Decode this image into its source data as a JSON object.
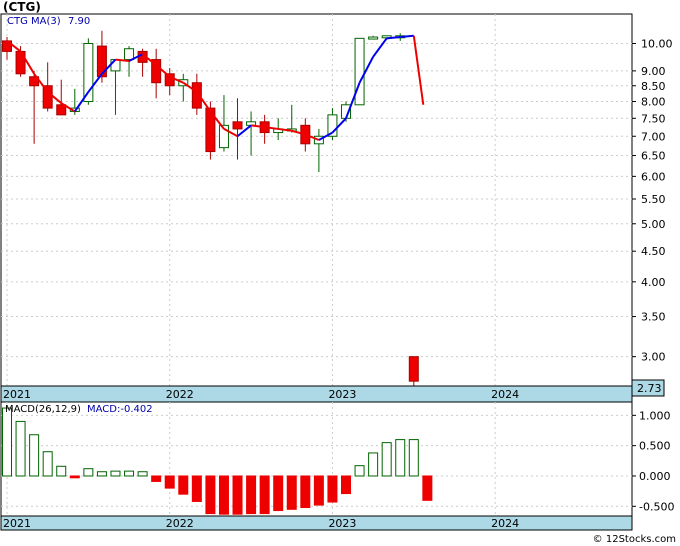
{
  "title": "(CTG)",
  "footer": "© 12Stocks.com",
  "chart_data": [
    {
      "type": "candlestick",
      "ticker_label": "CTG",
      "indicator_label": "MA(3)",
      "indicator_value": "7.90",
      "last_price_label": "2.73",
      "y_scale": "log",
      "ylim": [
        2.68,
        11.2
      ],
      "y_ticks": [
        "10.00",
        "9.00",
        "8.50",
        "8.00",
        "7.50",
        "7.00",
        "6.50",
        "6.00",
        "5.50",
        "5.00",
        "4.50",
        "4.00",
        "3.50",
        "3.00"
      ],
      "x_labels": [
        "2021",
        "2022",
        "2023",
        "2024"
      ],
      "x_label_months": [
        0,
        12,
        24,
        36
      ],
      "grid": true,
      "candles": [
        {
          "m": 0,
          "o": 10.1,
          "h": 10.25,
          "l": 9.4,
          "c": 9.7
        },
        {
          "m": 1,
          "o": 9.7,
          "h": 9.9,
          "l": 8.8,
          "c": 8.9
        },
        {
          "m": 2,
          "o": 8.8,
          "h": 9.0,
          "l": 6.8,
          "c": 8.5
        },
        {
          "m": 3,
          "o": 8.5,
          "h": 9.3,
          "l": 7.7,
          "c": 7.8
        },
        {
          "m": 4,
          "o": 7.9,
          "h": 8.7,
          "l": 7.6,
          "c": 7.6
        },
        {
          "m": 5,
          "o": 7.7,
          "h": 8.4,
          "l": 7.6,
          "c": 7.8
        },
        {
          "m": 6,
          "o": 8.0,
          "h": 10.2,
          "l": 7.9,
          "c": 10.0
        },
        {
          "m": 7,
          "o": 9.9,
          "h": 10.5,
          "l": 8.6,
          "c": 8.8
        },
        {
          "m": 8,
          "o": 9.0,
          "h": 9.3,
          "l": 7.6,
          "c": 9.4
        },
        {
          "m": 9,
          "o": 9.4,
          "h": 9.9,
          "l": 8.8,
          "c": 9.8
        },
        {
          "m": 10,
          "o": 9.7,
          "h": 9.8,
          "l": 8.8,
          "c": 9.3
        },
        {
          "m": 11,
          "o": 9.4,
          "h": 9.8,
          "l": 8.1,
          "c": 8.6
        },
        {
          "m": 12,
          "o": 8.9,
          "h": 9.1,
          "l": 8.2,
          "c": 8.5
        },
        {
          "m": 13,
          "o": 8.5,
          "h": 8.9,
          "l": 8.0,
          "c": 8.7
        },
        {
          "m": 14,
          "o": 8.6,
          "h": 8.9,
          "l": 7.6,
          "c": 7.8
        },
        {
          "m": 15,
          "o": 7.8,
          "h": 8.0,
          "l": 6.4,
          "c": 6.6
        },
        {
          "m": 16,
          "o": 6.7,
          "h": 8.2,
          "l": 6.6,
          "c": 7.3
        },
        {
          "m": 17,
          "o": 7.4,
          "h": 8.1,
          "l": 6.4,
          "c": 7.2
        },
        {
          "m": 18,
          "o": 7.3,
          "h": 7.7,
          "l": 6.5,
          "c": 7.4
        },
        {
          "m": 19,
          "o": 7.4,
          "h": 7.6,
          "l": 6.8,
          "c": 7.1
        },
        {
          "m": 20,
          "o": 7.1,
          "h": 7.5,
          "l": 6.9,
          "c": 7.2
        },
        {
          "m": 21,
          "o": 7.2,
          "h": 7.9,
          "l": 7.1,
          "c": 7.2
        },
        {
          "m": 22,
          "o": 7.3,
          "h": 7.5,
          "l": 6.6,
          "c": 6.8
        },
        {
          "m": 23,
          "o": 6.8,
          "h": 7.2,
          "l": 6.1,
          "c": 7.0
        },
        {
          "m": 24,
          "o": 7.0,
          "h": 7.8,
          "l": 6.9,
          "c": 7.6
        },
        {
          "m": 25,
          "o": 7.5,
          "h": 8.0,
          "l": 7.4,
          "c": 7.9
        },
        {
          "m": 26,
          "o": 7.9,
          "h": 10.2,
          "l": 7.9,
          "c": 10.2
        },
        {
          "m": 27,
          "o": 10.25,
          "h": 10.3,
          "l": 10.2,
          "c": 10.25
        },
        {
          "m": 28,
          "o": 10.25,
          "h": 10.3,
          "l": 10.2,
          "c": 10.3
        },
        {
          "m": 29,
          "o": 10.3,
          "h": 10.4,
          "l": 10.1,
          "c": 10.3
        },
        {
          "m": 30,
          "o": 3.0,
          "h": 3.0,
          "l": 2.68,
          "c": 2.73
        }
      ],
      "ma": [
        {
          "m": 0,
          "v": 10.1
        },
        {
          "m": 1,
          "v": 9.7
        },
        {
          "m": 2,
          "v": 8.9
        },
        {
          "m": 3,
          "v": 8.3
        },
        {
          "m": 4,
          "v": 7.95
        },
        {
          "m": 5,
          "v": 7.7
        },
        {
          "m": 6,
          "v": 8.3
        },
        {
          "m": 7,
          "v": 8.9
        },
        {
          "m": 8,
          "v": 9.4
        },
        {
          "m": 9,
          "v": 9.35
        },
        {
          "m": 10,
          "v": 9.6
        },
        {
          "m": 11,
          "v": 9.2
        },
        {
          "m": 12,
          "v": 8.8
        },
        {
          "m": 13,
          "v": 8.6
        },
        {
          "m": 14,
          "v": 8.3
        },
        {
          "m": 15,
          "v": 7.7
        },
        {
          "m": 16,
          "v": 7.2
        },
        {
          "m": 17,
          "v": 7.0
        },
        {
          "m": 18,
          "v": 7.3
        },
        {
          "m": 19,
          "v": 7.25
        },
        {
          "m": 20,
          "v": 7.2
        },
        {
          "m": 21,
          "v": 7.15
        },
        {
          "m": 22,
          "v": 7.05
        },
        {
          "m": 23,
          "v": 6.9
        },
        {
          "m": 24,
          "v": 7.1
        },
        {
          "m": 25,
          "v": 7.5
        },
        {
          "m": 26,
          "v": 8.6
        },
        {
          "m": 27,
          "v": 9.5
        },
        {
          "m": 28,
          "v": 10.2
        },
        {
          "m": 29,
          "v": 10.25
        },
        {
          "m": 30,
          "v": 10.3
        },
        {
          "m": 30.7,
          "v": 7.9
        }
      ],
      "colors": {
        "up_fill": "#ffffff",
        "up_stroke": "#006400",
        "down_fill": "#ee0000",
        "down_stroke": "#aa0000",
        "ma_up": "#0000ee",
        "ma_down": "#ee0000",
        "band": "#add8e6"
      }
    },
    {
      "type": "bar",
      "indicator_label": "MACD(26,12,9)",
      "value_label": "MACD:-0.402",
      "ylim": [
        -0.66,
        1.22
      ],
      "y_ticks": [
        "1.000",
        "0.500",
        "0.000",
        "-0.500"
      ],
      "x_labels": [
        "2021",
        "2022",
        "2023",
        "2024"
      ],
      "x_label_months": [
        0,
        12,
        24,
        36
      ],
      "grid": true,
      "values": [
        1.12,
        0.9,
        0.68,
        0.4,
        0.16,
        -0.03,
        0.12,
        0.07,
        0.08,
        0.08,
        0.07,
        -0.09,
        -0.2,
        -0.3,
        -0.42,
        -0.62,
        -0.63,
        -0.63,
        -0.62,
        -0.62,
        -0.57,
        -0.55,
        -0.52,
        -0.48,
        -0.43,
        -0.29,
        0.17,
        0.38,
        0.55,
        0.6,
        0.6,
        -0.402
      ],
      "colors": {
        "positive_stroke": "#006400",
        "negative_fill": "#ee0000"
      }
    }
  ]
}
